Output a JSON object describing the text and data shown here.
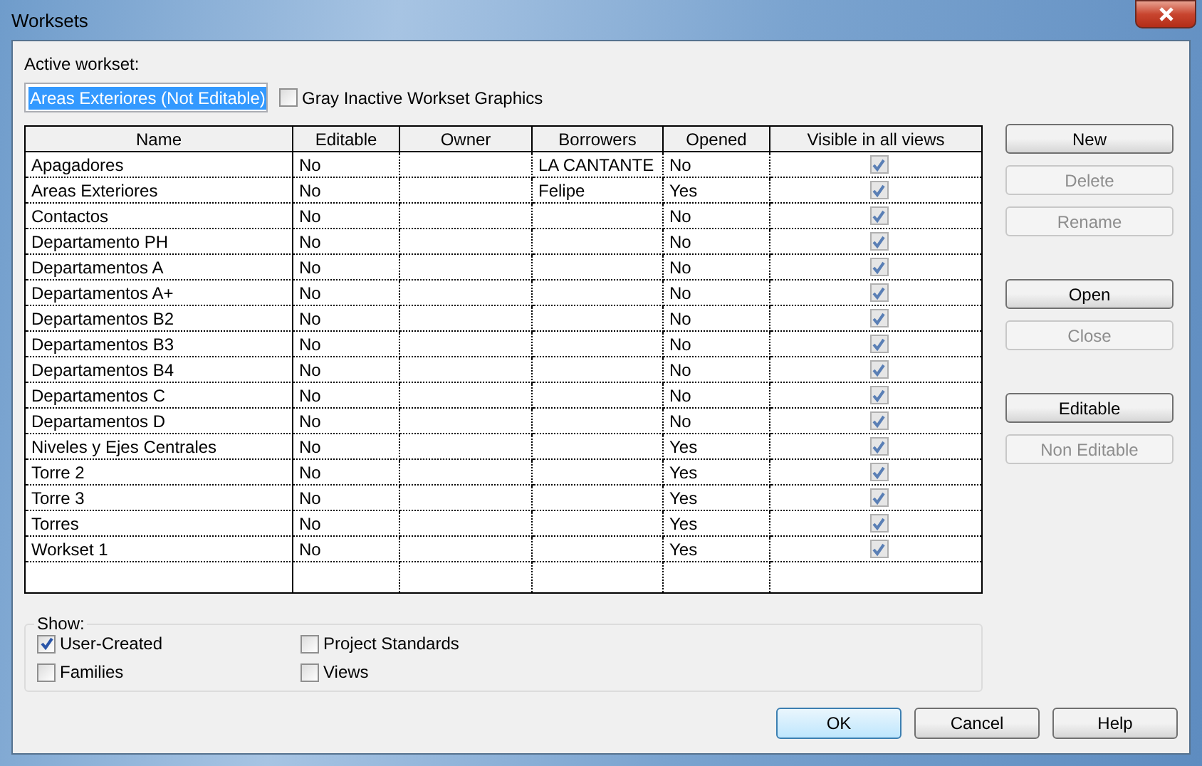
{
  "window": {
    "title": "Worksets"
  },
  "active_workset": {
    "label": "Active workset:",
    "value": "Areas Exteriores (Not Editable)"
  },
  "gray_inactive": {
    "label": "Gray Inactive Workset Graphics",
    "checked": false
  },
  "table": {
    "columns": [
      "Name",
      "Editable",
      "Owner",
      "Borrowers",
      "Opened",
      "Visible in all views"
    ],
    "rows": [
      {
        "name": "Apagadores",
        "editable": "No",
        "borrowers": "LA CANTANTE",
        "opened": "No",
        "visible": true
      },
      {
        "name": "Areas Exteriores",
        "editable": "No",
        "borrowers": "Felipe",
        "opened": "Yes",
        "visible": true
      },
      {
        "name": "Contactos",
        "editable": "No",
        "opened": "No",
        "visible": true
      },
      {
        "name": "Departamento PH",
        "editable": "No",
        "opened": "No",
        "visible": true
      },
      {
        "name": "Departamentos A",
        "editable": "No",
        "opened": "No",
        "visible": true
      },
      {
        "name": "Departamentos A+",
        "editable": "No",
        "opened": "No",
        "visible": true
      },
      {
        "name": "Departamentos B2",
        "editable": "No",
        "opened": "No",
        "visible": true
      },
      {
        "name": "Departamentos B3",
        "editable": "No",
        "opened": "No",
        "visible": true
      },
      {
        "name": "Departamentos B4",
        "editable": "No",
        "opened": "No",
        "visible": true
      },
      {
        "name": "Departamentos C",
        "editable": "No",
        "opened": "No",
        "visible": true
      },
      {
        "name": "Departamentos D",
        "editable": "No",
        "opened": "No",
        "visible": true
      },
      {
        "name": "Niveles y Ejes Centrales",
        "editable": "No",
        "opened": "Yes",
        "visible": true
      },
      {
        "name": "Torre 2",
        "editable": "No",
        "opened": "Yes",
        "visible": true
      },
      {
        "name": "Torre 3",
        "editable": "No",
        "opened": "Yes",
        "visible": true
      },
      {
        "name": "Torres",
        "editable": "No",
        "opened": "Yes",
        "visible": true
      },
      {
        "name": "Workset 1",
        "editable": "No",
        "opened": "Yes",
        "visible": true
      }
    ]
  },
  "side_button_groups": [
    [
      {
        "label": "New",
        "disabled": false
      },
      {
        "label": "Delete",
        "disabled": true
      },
      {
        "label": "Rename",
        "disabled": true
      }
    ],
    [
      {
        "label": "Open",
        "disabled": false
      },
      {
        "label": "Close",
        "disabled": true
      }
    ],
    [
      {
        "label": "Editable",
        "disabled": false
      },
      {
        "label": "Non Editable",
        "disabled": true
      }
    ]
  ],
  "show": {
    "label": "Show:",
    "options": [
      {
        "label": "User-Created",
        "checked": true
      },
      {
        "label": "Project Standards",
        "checked": false
      },
      {
        "label": "Families",
        "checked": false
      },
      {
        "label": "Views",
        "checked": false
      }
    ]
  },
  "buttons": [
    {
      "label": "OK",
      "default": true
    },
    {
      "label": "Cancel",
      "default": false
    },
    {
      "label": "Help",
      "default": false
    }
  ]
}
